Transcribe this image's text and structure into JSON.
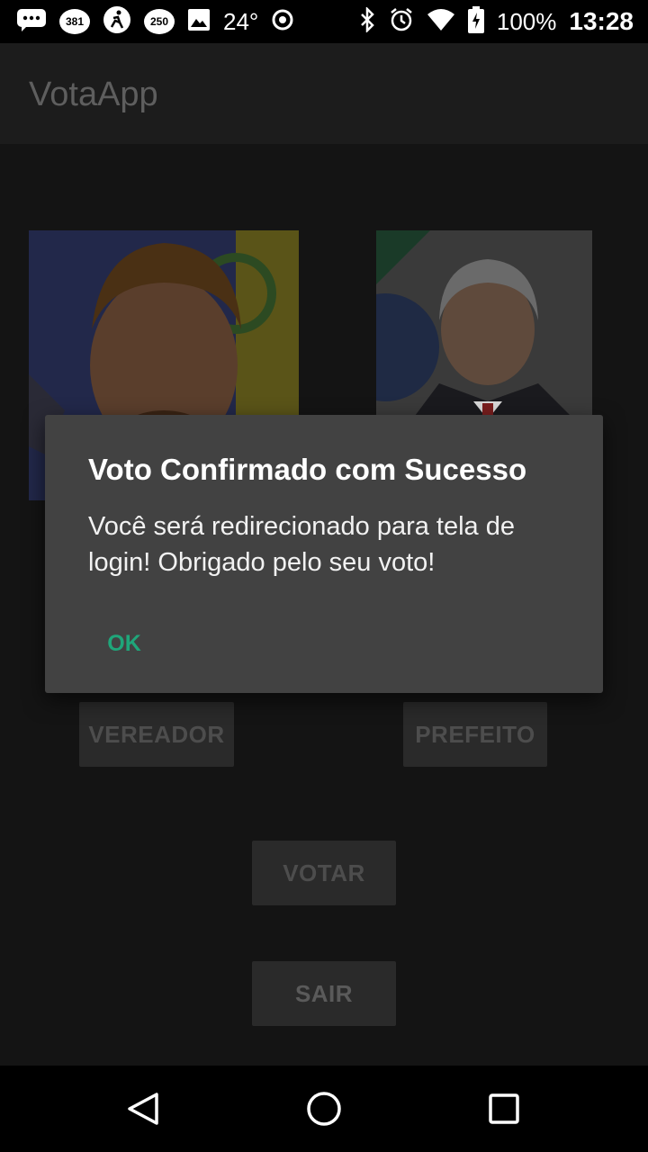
{
  "status_bar": {
    "notif_badge_1": "381",
    "notif_badge_2": "250",
    "temperature": "24°",
    "battery_percent": "100%",
    "time": "13:28"
  },
  "app_bar": {
    "title": "VotaApp"
  },
  "buttons": {
    "vereador": "VEREADOR",
    "prefeito": "PREFEITO",
    "votar": "VOTAR",
    "sair": "SAIR"
  },
  "dialog": {
    "title": "Voto Confirmado com Sucesso",
    "message": "Você será redirecionado para tela de login! Obrigado pelo seu voto!",
    "ok_label": "OK"
  },
  "colors": {
    "dialog_bg": "#424242",
    "accent": "#1fa67a",
    "scrim_bg": "#141414"
  },
  "icons": {
    "status": [
      "messages-icon",
      "mail-icon",
      "fitness-icon",
      "mail-icon",
      "image-icon",
      "location-icon",
      "bluetooth-icon",
      "alarm-icon",
      "wifi-icon",
      "battery-charging-icon"
    ],
    "nav": [
      "back-icon",
      "home-icon",
      "recents-icon"
    ]
  }
}
